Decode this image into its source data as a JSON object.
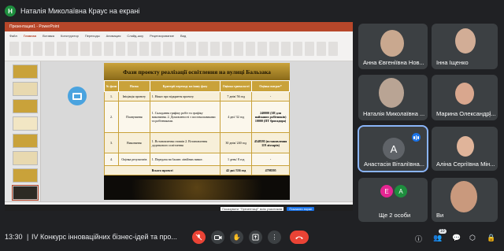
{
  "presenter": {
    "initial": "Н",
    "label": "Наталія Миколаївна Краус на екрані"
  },
  "ppt": {
    "window_title": "Презентация1 - PowerPoint",
    "tabs": [
      "Файл",
      "Главная",
      "Вставка",
      "Конструктор",
      "Переходы",
      "Анимация",
      "Слайд-шоу",
      "Рецензирование",
      "Вид"
    ],
    "active_tab": 1
  },
  "slide": {
    "title": "Фази проекту реалізації освітлення на вулиці Бальзака",
    "columns": [
      "№ фази",
      "Назва",
      "Критерії переходу на іншу фазу",
      "Оцінка тривалості",
      "Оцінка витрат*"
    ],
    "rows": [
      {
        "n": "1.",
        "name": "Ініціація проекту",
        "criteria": "1. Наказ про відкриття проекту.",
        "duration": "7 днів/ 56 год",
        "cost": "-"
      },
      {
        "n": "2.",
        "name": "Планування",
        "criteria": "1. Складання графіку робіт та графіку виконання. 2. Домовленості з постачальниками та робітниками.",
        "duration": "4 дні/ 32 год",
        "cost": "240000 (ЗП для найманих робітників) 10000 (ПТ бригадира)"
      },
      {
        "n": "3.",
        "name": "Виконання",
        "criteria": "1. Встановлення стовпів 2. Встановлення додаткового освітлення",
        "duration": "30 днів/ 240 год",
        "cost": "4548595 (встановлення 119 ліхтарів)"
      },
      {
        "n": "4.",
        "name": "Оцінка результатів",
        "criteria": "1. Передача на баланс лінійних вимог.",
        "duration": "1 день/ 8 год",
        "cost": "-"
      }
    ],
    "total": {
      "label": "Всього проекті",
      "duration": "42 дні /336 год",
      "cost": "4798595"
    }
  },
  "snackbar": {
    "text": "Показувати \"Презентації\" всім учасникам ",
    "button": "Показати екран"
  },
  "participants": [
    {
      "name": "Анна Євгеніївна Нов...",
      "bg": "#5c5149"
    },
    {
      "name": "Інна Іщенко",
      "bg": "#6a5a52"
    },
    {
      "name": "Наталія Миколаївна ...",
      "bg": "#7c7468"
    },
    {
      "name": "Марина Олександрі...",
      "bg": "#4d2c2a"
    },
    {
      "name": "Анастасія Віталіївна...",
      "initial": "А",
      "bg": "#3c4043"
    },
    {
      "name": "Аліна Сергіївна Мін...",
      "bg": "#5e4f43"
    },
    {
      "name": "Ще 2 особи",
      "extra": [
        "Е",
        "А"
      ],
      "extra_colors": [
        "#e52592",
        "#1e8e3e"
      ],
      "bg": "#3c4043"
    },
    {
      "name": "Ви",
      "bg": "#6b5548"
    }
  ],
  "bottom": {
    "time": "13:30",
    "separator": "|",
    "meeting_title": "IV Конкурс інноваційних бізнес-ідей та про...",
    "participant_count": "10"
  }
}
